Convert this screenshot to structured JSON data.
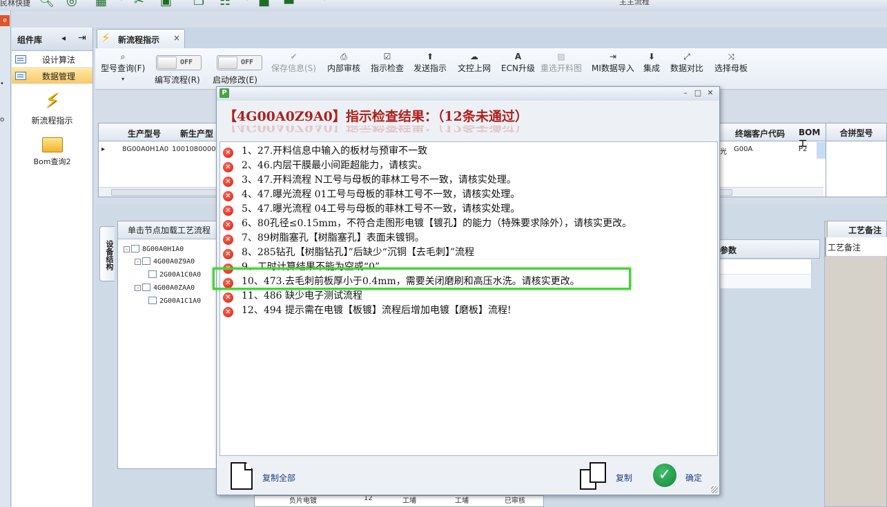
{
  "topbar": {
    "quick_label": "民林快捷",
    "title_fragment": "主主流程"
  },
  "sidebar": {
    "title": "组件库",
    "items": [
      {
        "label": "设计算法",
        "selected": false
      },
      {
        "label": "数据管理",
        "selected": true
      }
    ],
    "big_items": [
      {
        "label": "新流程指示",
        "icon": "lightning-icon"
      },
      {
        "label": "Bom查询2",
        "icon": "folder-icon"
      }
    ]
  },
  "tab": {
    "label": "新流程指示",
    "close": "×"
  },
  "ribbon": {
    "model_query": "型号查询(F)",
    "toggles": [
      {
        "state": "OFF",
        "label": "编写流程(R)"
      },
      {
        "state": "OFF",
        "label": "启动修改(E)"
      }
    ],
    "buttons": [
      {
        "label": "保存信息(S)",
        "icon": "check-icon",
        "enabled": false
      },
      {
        "label": "内部审核",
        "icon": "printer-icon",
        "enabled": true
      },
      {
        "label": "指示检查",
        "icon": "checkbox-icon",
        "enabled": true
      },
      {
        "label": "发送指示",
        "icon": "upload-icon",
        "enabled": true
      },
      {
        "label": "文控上网",
        "icon": "cloud-upload-icon",
        "enabled": true
      },
      {
        "label": "ECN升级",
        "icon": "font-icon",
        "enabled": true
      },
      {
        "label": "重选开料图",
        "icon": "image-icon",
        "enabled": false
      },
      {
        "label": "MI数据导入",
        "icon": "import-icon",
        "enabled": true
      },
      {
        "label": "集成",
        "icon": "download-icon",
        "enabled": true
      },
      {
        "label": "数据对比",
        "icon": "compare-icon",
        "enabled": true
      },
      {
        "label": "选择母板",
        "icon": "shuffle-icon",
        "enabled": true
      }
    ]
  },
  "grid": {
    "headers": {
      "prod_model": "生产型号",
      "new_prod_model": "新生产型",
      "end_customer_code": "终端客户代码",
      "bom": "BOM工"
    },
    "row": {
      "prod_model": "8G00A0H1A0",
      "new_prod_model": "100108000038",
      "frag": "光",
      "end_customer_code": "G00A",
      "bom": "P2"
    },
    "merge_header": "合拼型号"
  },
  "tree": {
    "side_tab": "设备结构",
    "header": "单击节点加载工艺流程",
    "nodes": [
      "8G00A0H1A0",
      "4G00A0Z9A0",
      "2G00A1C0A0",
      "4G00A0ZAA0",
      "2G00A1C1A0"
    ]
  },
  "right": {
    "param_header": "参数",
    "craft_tab": "工艺备注",
    "craft_sub": "工艺备注"
  },
  "dialog": {
    "heading": "【4G00A0Z9A0】指示检查结果：（12条未通过）",
    "items": [
      "1、27.开料信息中输入的板材与预审不一致",
      "2、46.内层干膜最小间距超能力，请核实。",
      "3、47.开料流程 N工号与母板的菲林工号不一致，请核实处理。",
      "4、47.曝光流程 01工号与母板的菲林工号不一致，请核实处理。",
      "5、47.曝光流程 04工号与母板的菲林工号不一致，请核实处理。",
      "6、80孔径≤0.15mm，不符合走图形电镀【镀孔】的能力（特殊要求除外），请核实更改。",
      "7、89树脂塞孔【树脂塞孔】表面未镀铜。",
      "8、285钻孔【树脂钻孔】”后缺少“沉铜【去毛刺】”流程",
      "9、工时计算结果不能为空或“0”",
      "10、473.去毛刺前板厚小于0.4mm，需要关闭磨刷和高压水洗。请核实更改。",
      "11、486 缺少电子测试流程",
      "12、494 提示需在电镀【板镀】流程后增加电镀【磨板】流程!"
    ],
    "highlighted_index": 9,
    "footer": {
      "copy_all": "复制全部",
      "copy": "复制",
      "ok": "确定"
    }
  },
  "peek": {
    "c1": "负片电镀",
    "c2": "12",
    "c3": "工埔",
    "c4": "工埔",
    "c5": "已审核"
  }
}
